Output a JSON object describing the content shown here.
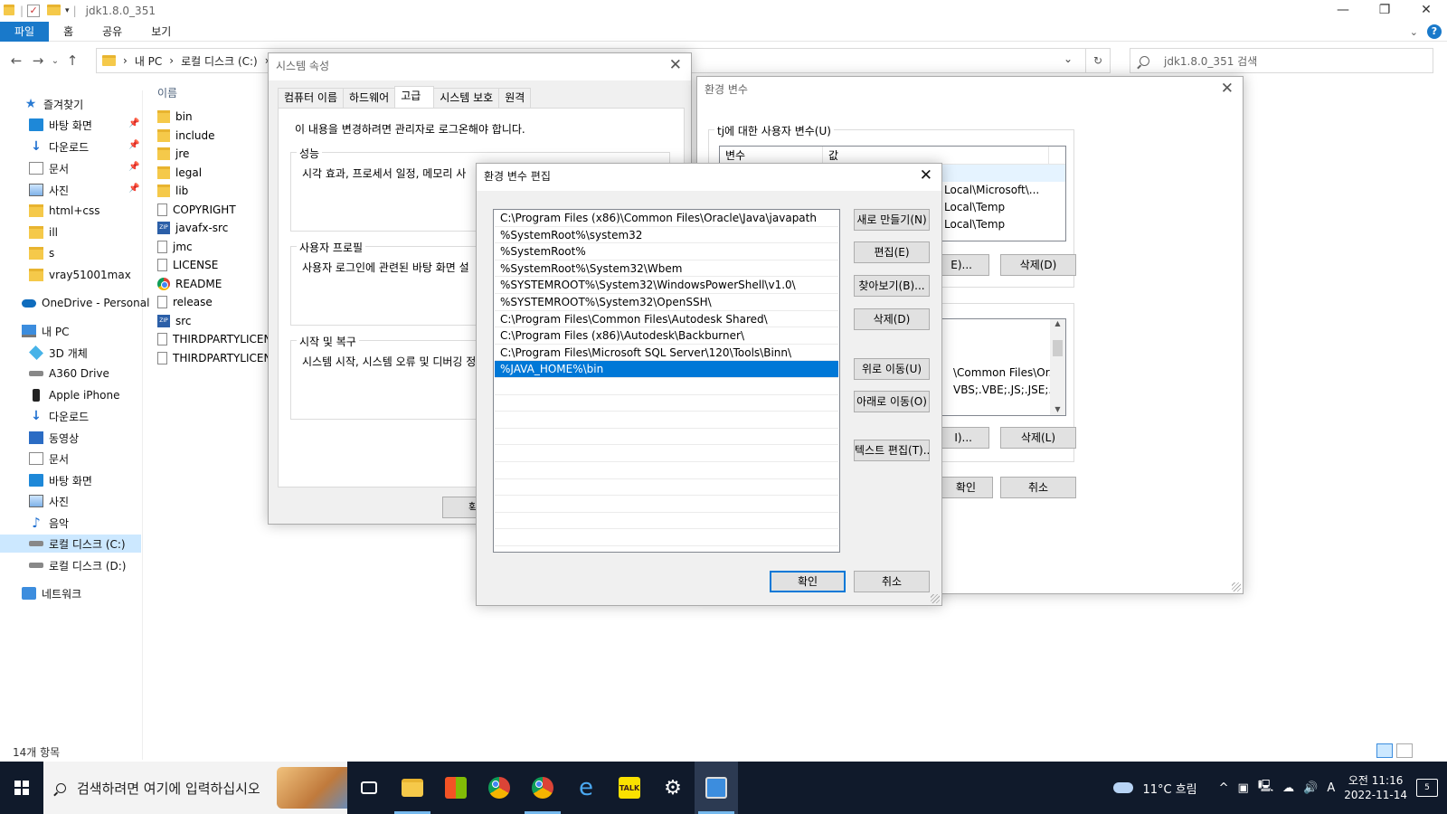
{
  "explorer": {
    "title": "jdk1.8.0_351",
    "ribbon_tabs": [
      "파일",
      "홈",
      "공유",
      "보기"
    ],
    "breadcrumb": [
      "내 PC",
      "로컬 디스크 (C:)"
    ],
    "search_placeholder": "jdk1.8.0_351 검색",
    "nav": {
      "quick_access": "즐겨찾기",
      "items": [
        "바탕 화면",
        "다운로드",
        "문서",
        "사진",
        "html+css",
        "ill",
        "s",
        "vray51001max"
      ],
      "onedrive": "OneDrive - Personal",
      "this_pc": "내 PC",
      "pc_items": [
        "3D 개체",
        "A360 Drive",
        "Apple iPhone",
        "다운로드",
        "동영상",
        "문서",
        "바탕 화면",
        "사진",
        "음악",
        "로컬 디스크 (C:)",
        "로컬 디스크 (D:)"
      ],
      "network": "네트워크"
    },
    "column_name": "이름",
    "files": [
      "bin",
      "include",
      "jre",
      "legal",
      "lib",
      "COPYRIGHT",
      "javafx-src",
      "jmc",
      "LICENSE",
      "README",
      "release",
      "src",
      "THIRDPARTYLICENSE",
      "THIRDPARTYLICENSE"
    ],
    "status": "14개 항목"
  },
  "system_properties": {
    "title": "시스템 속성",
    "tabs": [
      "컴퓨터 이름",
      "하드웨어",
      "고급",
      "시스템 보호",
      "원격"
    ],
    "admin_note": "이 내용을 변경하려면 관리자로 로그온해야 합니다.",
    "performance": {
      "label": "성능",
      "text": "시각 효과, 프로세서 일정, 메모리 사"
    },
    "user_profile": {
      "label": "사용자 프로필",
      "text": "사용자 로그인에 관련된 바탕 화면 설"
    },
    "startup": {
      "label": "시작 및 복구",
      "text": "시스템 시작, 시스템 오류 및 디버깅 정"
    },
    "ok_partial": "확"
  },
  "env_vars": {
    "title": "환경 변수",
    "user_group": "tj에 대한 사용자 변수(U)",
    "col_var": "변수",
    "col_val": "값",
    "user_values": [
      "Local\\Microsoft\\...",
      "Local\\Temp",
      "Local\\Temp"
    ],
    "edit_partial": "E)...",
    "delete_user": "삭제(D)",
    "system_values": [
      "\\Common Files\\Or...",
      "VBS;.VBE;.JS;.JSE;.W..."
    ],
    "edit_sys_partial": "I)...",
    "delete_sys": "삭제(L)",
    "ok": "확인",
    "cancel": "취소"
  },
  "edit_env": {
    "title": "환경 변수 편집",
    "paths": [
      "C:\\Program Files (x86)\\Common Files\\Oracle\\Java\\javapath",
      "%SystemRoot%\\system32",
      "%SystemRoot%",
      "%SystemRoot%\\System32\\Wbem",
      "%SYSTEMROOT%\\System32\\WindowsPowerShell\\v1.0\\",
      "%SYSTEMROOT%\\System32\\OpenSSH\\",
      "C:\\Program Files\\Common Files\\Autodesk Shared\\",
      "C:\\Program Files (x86)\\Autodesk\\Backburner\\",
      "C:\\Program Files\\Microsoft SQL Server\\120\\Tools\\Binn\\",
      "%JAVA_HOME%\\bin"
    ],
    "selected_index": 9,
    "buttons": {
      "new": "새로 만들기(N)",
      "edit": "편집(E)",
      "browse": "찾아보기(B)...",
      "delete": "삭제(D)",
      "move_up": "위로 이동(U)",
      "move_down": "아래로 이동(O)",
      "edit_text": "텍스트 편집(T)...",
      "ok": "확인",
      "cancel": "취소"
    }
  },
  "taskbar": {
    "search_placeholder": "검색하려면 여기에 입력하십시오",
    "weather": "11°C  흐림",
    "time": "오전 11:16",
    "date": "2022-11-14",
    "ime": "A",
    "notifications": "5"
  }
}
